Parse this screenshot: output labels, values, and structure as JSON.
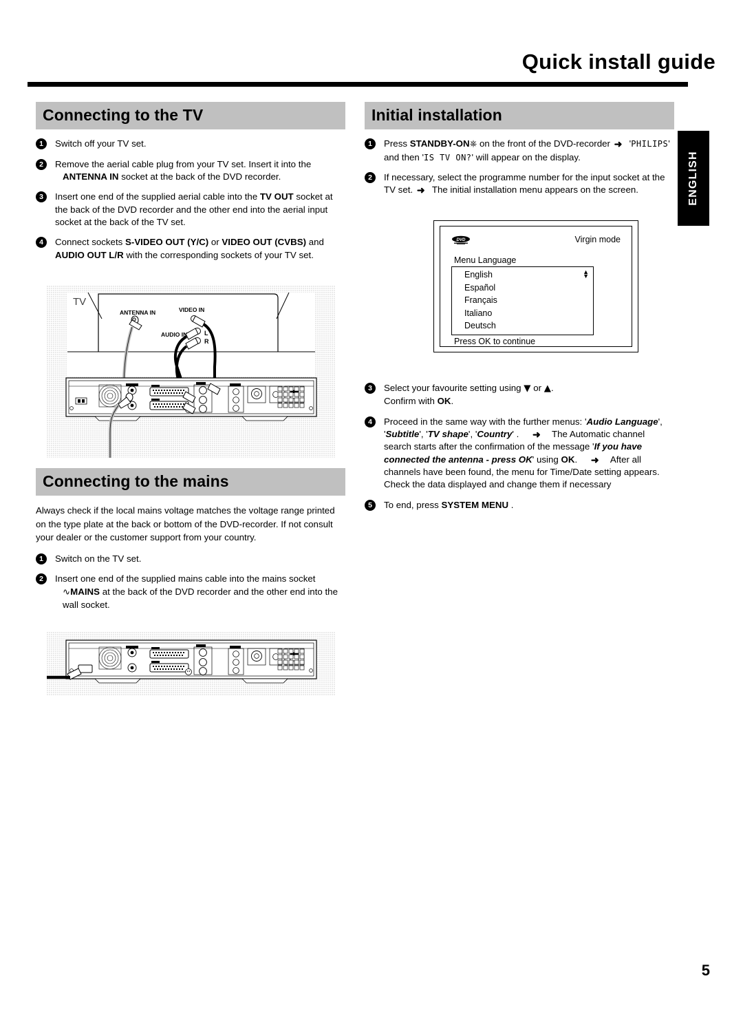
{
  "header": {
    "title": "Quick install guide",
    "side_tab": "ENGLISH"
  },
  "page_number": "5",
  "left_column": {
    "section1": {
      "heading": "Connecting to the TV",
      "steps": [
        {
          "num": "1",
          "text": "Switch off your TV set."
        },
        {
          "num": "2",
          "text": "Remove the aerial cable plug from your TV set. Insert it into the",
          "bold1": "ANTENNA IN",
          "text2": "socket at the back of the DVD recorder."
        },
        {
          "num": "3",
          "text": "Insert one end of the supplied aerial cable into the",
          "bold1": "TV OUT",
          "text2": "socket at the back of the DVD recorder and the other end into the aerial input socket at the back of the TV set."
        },
        {
          "num": "4",
          "text": "Connect sockets",
          "bold1": "S-VIDEO OUT (Y/C)",
          "mid1": "or",
          "bold2": "VIDEO OUT (CVBS)",
          "mid2": "and",
          "bold3": "AUDIO OUT L/R",
          "text2": "with the corresponding sockets of your TV set."
        }
      ]
    },
    "figure_tv": {
      "caption_tv": "TV",
      "labels": [
        "ANTENNA IN",
        "VIDEO IN",
        "AUDIO IN",
        "L",
        "R"
      ]
    },
    "section2": {
      "heading": "Connecting to the mains",
      "paragraph": "Always check if the local mains voltage matches the voltage range printed on the type plate at the back or bottom of the DVD-recorder. If not consult your dealer or the customer support from your country.",
      "steps": [
        {
          "num": "1",
          "text": "Switch on the TV set."
        },
        {
          "num": "2",
          "text": "Insert one end of the supplied mains cable into the mains socket",
          "bold1": "MAINS",
          "text2": "at the back of the DVD recorder and the other end into the wall socket."
        }
      ]
    }
  },
  "right_column": {
    "section": {
      "heading": "Initial installation",
      "step1": {
        "num": "1",
        "pre": "Press",
        "bold": "STANDBY-ON",
        "post": "on the front of the DVD-recorder",
        "arrow": {
          "lcd1": "PHILIPS",
          "mid": "and then",
          "lcd2": "IS TV ON?",
          "tail": "will appear on the display."
        }
      },
      "step2": {
        "num": "2",
        "text": "If necessary, select the programme number for the input socket at the TV set.",
        "arrow": "The initial installation menu appears on the screen."
      },
      "step3": {
        "num": "3",
        "pre": "Select your favourite setting using",
        "down": "▼",
        "or": "or",
        "up": "▲",
        "dot": ".",
        "confirm_pre": "Confirm with",
        "confirm_bold": "OK",
        "confirm_dot": "."
      },
      "step4": {
        "num": "4",
        "pre": "Proceed in the same way with the further menus:",
        "menus": [
          "Audio Language",
          "Subtitle",
          "TV shape",
          "Country"
        ],
        "arrow1_pre": "The Automatic channel search starts after the confirmation of the message",
        "arrow1_bold": "If you have connected the antenna - press OK",
        "arrow1_mid": "using",
        "arrow1_ok": "OK",
        "arrow1_end": ".",
        "arrow2_line1": "After all channels have been found, the menu for Time/Date setting appears.",
        "arrow2_line2": "Check the data displayed and change them if necessary"
      },
      "step5": {
        "num": "5",
        "pre": "To end, press",
        "bold": "SYSTEM MENU",
        "post": "."
      }
    },
    "osd": {
      "logo": "DVD",
      "mode": "Virgin mode",
      "menu_label": "Menu Language",
      "options": [
        "English",
        "Español",
        "Français",
        "Italiano",
        "Deutsch"
      ],
      "footer": "Press OK to continue"
    }
  },
  "colors": {
    "section_bar": "#c0c0c0",
    "tab_bg": "#000000",
    "text": "#000000"
  }
}
